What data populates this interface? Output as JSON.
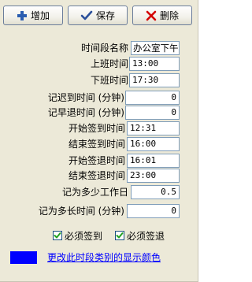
{
  "toolbar": {
    "add_label": "增加",
    "save_label": "保存",
    "delete_label": "删除"
  },
  "fields": [
    {
      "label": "时间段名称",
      "value": "办公室下午"
    },
    {
      "label": "上班时间",
      "value": "13:00"
    },
    {
      "label": "下班时间",
      "value": "17:30"
    },
    {
      "label": "记迟到时间 (分钟)",
      "value": "0"
    },
    {
      "label": "记早退时间 (分钟)",
      "value": "0"
    },
    {
      "label": "开始签到时间",
      "value": "12:31"
    },
    {
      "label": "结束签到时间",
      "value": "16:00"
    },
    {
      "label": "开始签退时间",
      "value": "16:01"
    },
    {
      "label": "结束签退时间",
      "value": "23:00"
    },
    {
      "label": "记为多少工作日",
      "value": "0.5"
    },
    {
      "label": "记为多长时间 (分钟)",
      "value": "0"
    }
  ],
  "checkboxes": {
    "must_sign_in": {
      "label": "必须签到",
      "checked": true
    },
    "must_sign_out": {
      "label": "必须签退",
      "checked": true
    }
  },
  "color": {
    "swatch": "#0000ff",
    "link_label": "更改此时段类别的显示颜色"
  }
}
